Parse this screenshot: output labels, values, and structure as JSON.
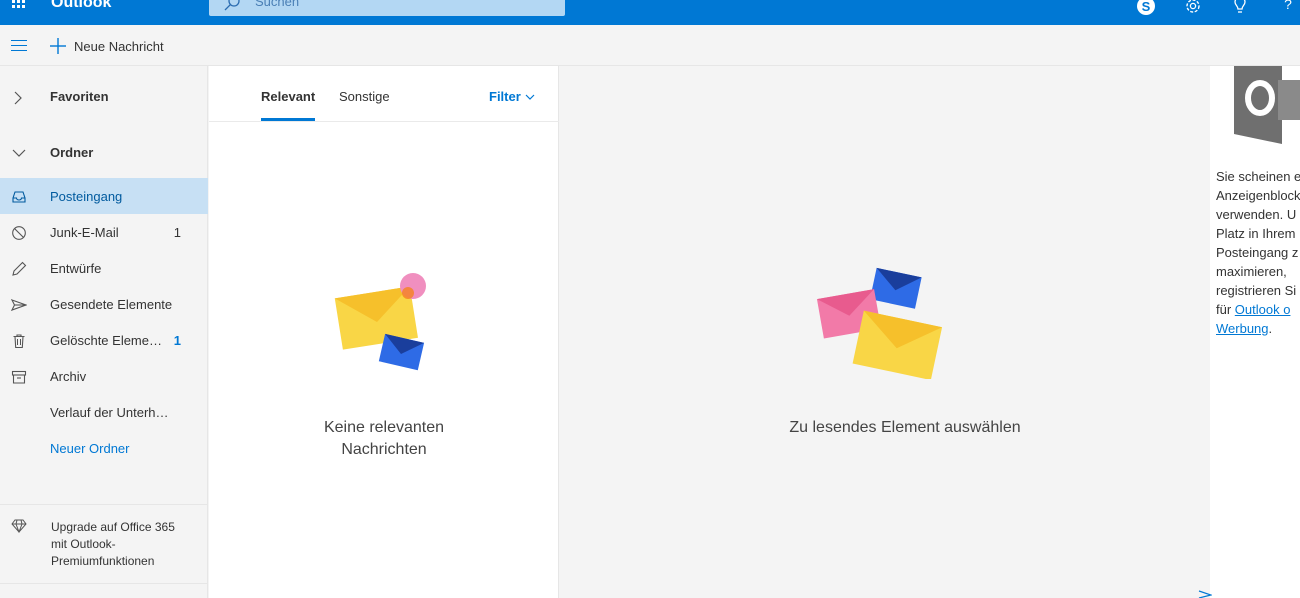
{
  "app": {
    "title": "Outlook",
    "brand_color": "#0078d4"
  },
  "search": {
    "placeholder": "Suchen"
  },
  "topbar_icons": [
    "skype-icon",
    "gear-icon",
    "lightbulb-icon",
    "help-icon"
  ],
  "command": {
    "new_message": "Neue Nachricht"
  },
  "nav": {
    "favorites": "Favoriten",
    "folders": "Ordner",
    "items": [
      {
        "label": "Posteingang",
        "icon": "inbox-icon",
        "count": "",
        "selected": true
      },
      {
        "label": "Junk-E-Mail",
        "icon": "block-icon",
        "count": "1"
      },
      {
        "label": "Entwürfe",
        "icon": "pencil-icon",
        "count": ""
      },
      {
        "label": "Gesendete Elemente",
        "icon": "send-icon",
        "count": ""
      },
      {
        "label": "Gelöschte Eleme…",
        "icon": "trash-icon",
        "count": "1"
      },
      {
        "label": "Archiv",
        "icon": "archive-icon",
        "count": ""
      },
      {
        "label": "Verlauf der Unterh…",
        "icon": "",
        "count": ""
      },
      {
        "label": "Neuer Ordner",
        "icon": "",
        "count": ""
      }
    ],
    "upgrade": "Upgrade auf Office 365 mit Outlook-Premiumfunktionen"
  },
  "list": {
    "tab_relevant": "Relevant",
    "tab_other": "Sonstige",
    "filter": "Filter",
    "empty_line1": "Keine relevanten",
    "empty_line2": "Nachrichten"
  },
  "reading": {
    "empty": "Zu lesendes Element auswählen"
  },
  "ad": {
    "lines": [
      "Sie scheinen e",
      "Anzeigenblock",
      "verwenden. U",
      "Platz in Ihrem",
      "Posteingang z",
      "maximieren,",
      "registrieren Si"
    ],
    "prefix": "für ",
    "link1": "Outlook o",
    "link2": "Werbung",
    "suffix": "."
  }
}
